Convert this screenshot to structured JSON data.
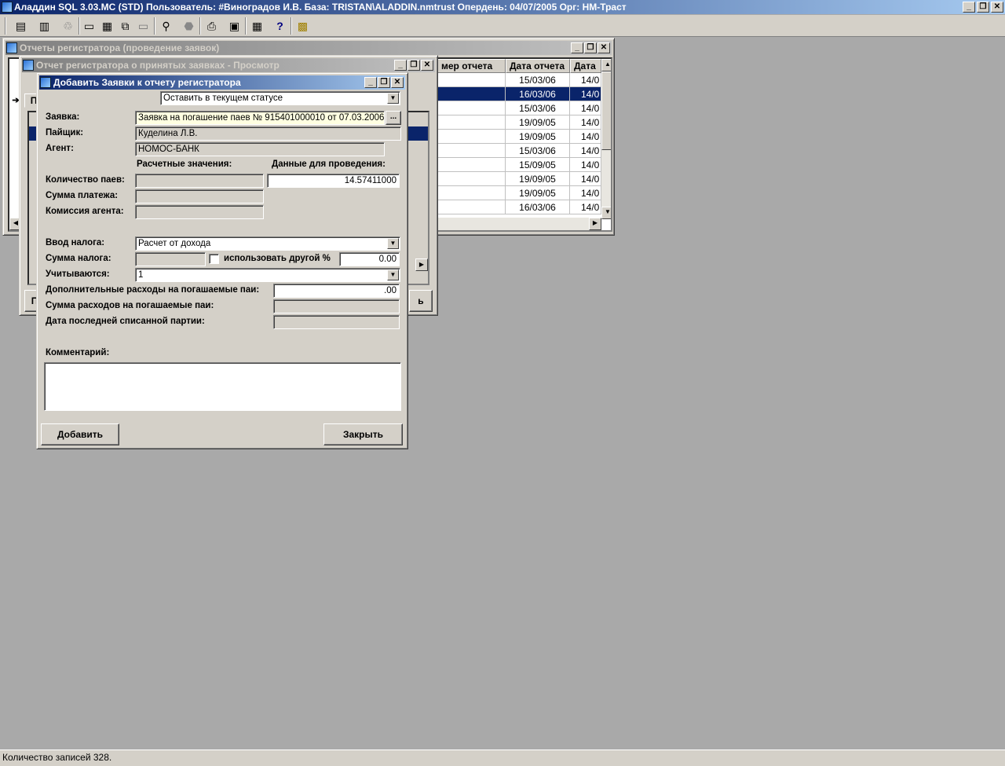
{
  "app": {
    "title": "Аладдин SQL 3.03.MC (STD)  Пользователь: #Виноградов И.В. База: TRISTAN\\ALADDIN.nmtrust Опердень: 04/07/2005 Орг: НМ-Траст"
  },
  "window_buttons": {
    "minimize": "_",
    "restore": "❐",
    "close": "✕"
  },
  "toolbar": {
    "icons": [
      "list-icon",
      "database-icon",
      "recycle-icon",
      "window-icon",
      "tile-icon",
      "cascade-icon",
      "minimize-all-icon",
      "binoculars-icon",
      "stop-icon",
      "printer-icon",
      "save-icon",
      "calendar-icon",
      "help-icon",
      "exit-icon"
    ]
  },
  "reports_window": {
    "title": "Отчеты регистратора (проведение заявок)",
    "columns": [
      "мер отчета",
      "Дата отчета",
      "Дата"
    ],
    "rows": [
      {
        "date": "15/03/06",
        "date2": "14/0"
      },
      {
        "date": "16/03/06",
        "date2": "14/0"
      },
      {
        "date": "15/03/06",
        "date2": "14/0"
      },
      {
        "date": "19/09/05",
        "date2": "14/0"
      },
      {
        "date": "19/09/05",
        "date2": "14/0"
      },
      {
        "date": "15/03/06",
        "date2": "14/0"
      },
      {
        "date": "15/09/05",
        "date2": "14/0"
      },
      {
        "date": "19/09/05",
        "date2": "14/0"
      },
      {
        "date": "19/09/05",
        "date2": "14/0"
      },
      {
        "date": "16/03/06",
        "date2": "14/0"
      }
    ]
  },
  "view_window": {
    "title": "Отчет регистратора о принятых заявках - Просмотр",
    "tab_partial": "П",
    "button_left": "П",
    "button_right": "ь"
  },
  "dialog": {
    "title": "Добавить Заявки к отчету регистратора",
    "status_select": "Оставить в текущем статусе",
    "labels": {
      "order": "Заявка:",
      "holder": "Пайщик:",
      "agent": "Агент:",
      "calc_values": "Расчетные значения:",
      "posting_data": "Данные для проведения:",
      "units_count": "Количество паев:",
      "payment_sum": "Сумма платежа:",
      "agent_fee": "Комиссия агента:",
      "tax_input": "Ввод налога:",
      "tax_sum": "Сумма налога:",
      "use_other_pct": "использовать другой %",
      "counted": "Учитываются:",
      "extra_costs": "Дополнительные расходы на погашаемые паи:",
      "costs_sum": "Сумма расходов на погашаемые паи:",
      "last_batch_date": "Дата последней списанной партии:",
      "comment": "Комментарий:"
    },
    "values": {
      "order": "Заявка на погашение паев № 915401000010 от 07.03.2006",
      "holder": "Куделина Л.В.",
      "agent": "НОМОС-БАНК",
      "units_count": "14.57411000",
      "tax_input": "Расчет от дохода",
      "tax_pct": "0.00",
      "counted": "1",
      "extra_costs": ".00"
    },
    "ellipsis": "...",
    "buttons": {
      "add": "Добавить",
      "close": "Закрыть"
    }
  },
  "status_bar": {
    "text": "Количество записей 328."
  }
}
